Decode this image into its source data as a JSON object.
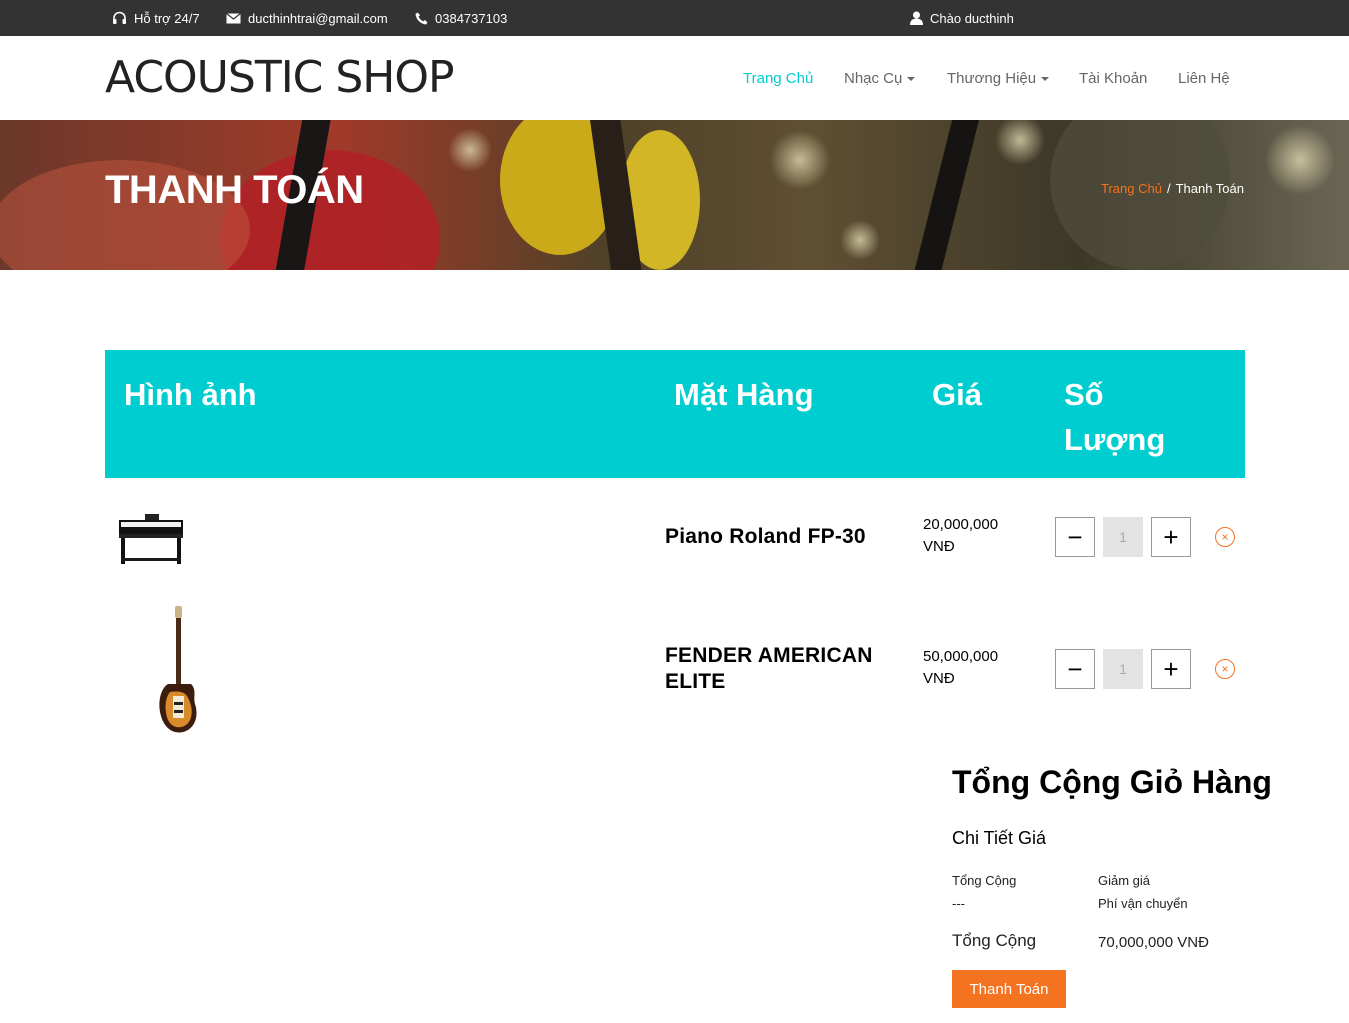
{
  "topbar": {
    "support": "Hỗ trợ 24/7",
    "email": "ducthinhtrai@gmail.com",
    "phone": "0384737103",
    "greeting": "Chào ducthinh"
  },
  "header": {
    "logo": "ACOUSTIC SHOP",
    "nav": [
      {
        "label": "Trang Chủ",
        "active": true
      },
      {
        "label": "Nhạc Cụ",
        "dropdown": true
      },
      {
        "label": "Thương Hiệu",
        "dropdown": true
      },
      {
        "label": "Tài Khoản"
      },
      {
        "label": "Liên Hệ"
      }
    ]
  },
  "banner": {
    "title": "THANH TOÁN",
    "breadcrumb": [
      "Trang Chủ",
      "/",
      "Thanh Toán"
    ]
  },
  "cart": {
    "headers": [
      "Hình ảnh",
      "Mặt Hàng",
      "Giá",
      "Số Lượng"
    ],
    "items": [
      {
        "name": "Piano Roland FP-30",
        "price": "20,000,000 VNĐ",
        "qty": "1",
        "icon": "digital-piano-image"
      },
      {
        "name": "FENDER AMERICAN ELITE",
        "price": "50,000,000 VNĐ",
        "qty": "1",
        "icon": "bass-guitar-image"
      }
    ]
  },
  "totals": {
    "title": "Tổng Cộng Giỏ Hàng",
    "subtitle": "Chi Tiết Giá",
    "subtotal_label": "Tổng Cộng",
    "subtotal_value": "---",
    "discount_label": "Giảm giá",
    "shipping_label": "Phí vận chuyển",
    "total_label": "Tổng Cộng",
    "total_value": "70,000,000 VNĐ",
    "checkout_label": "Thanh Toán"
  },
  "colors": {
    "accent": "#00cdd0",
    "orange": "#f47320",
    "topbar": "#333333"
  }
}
